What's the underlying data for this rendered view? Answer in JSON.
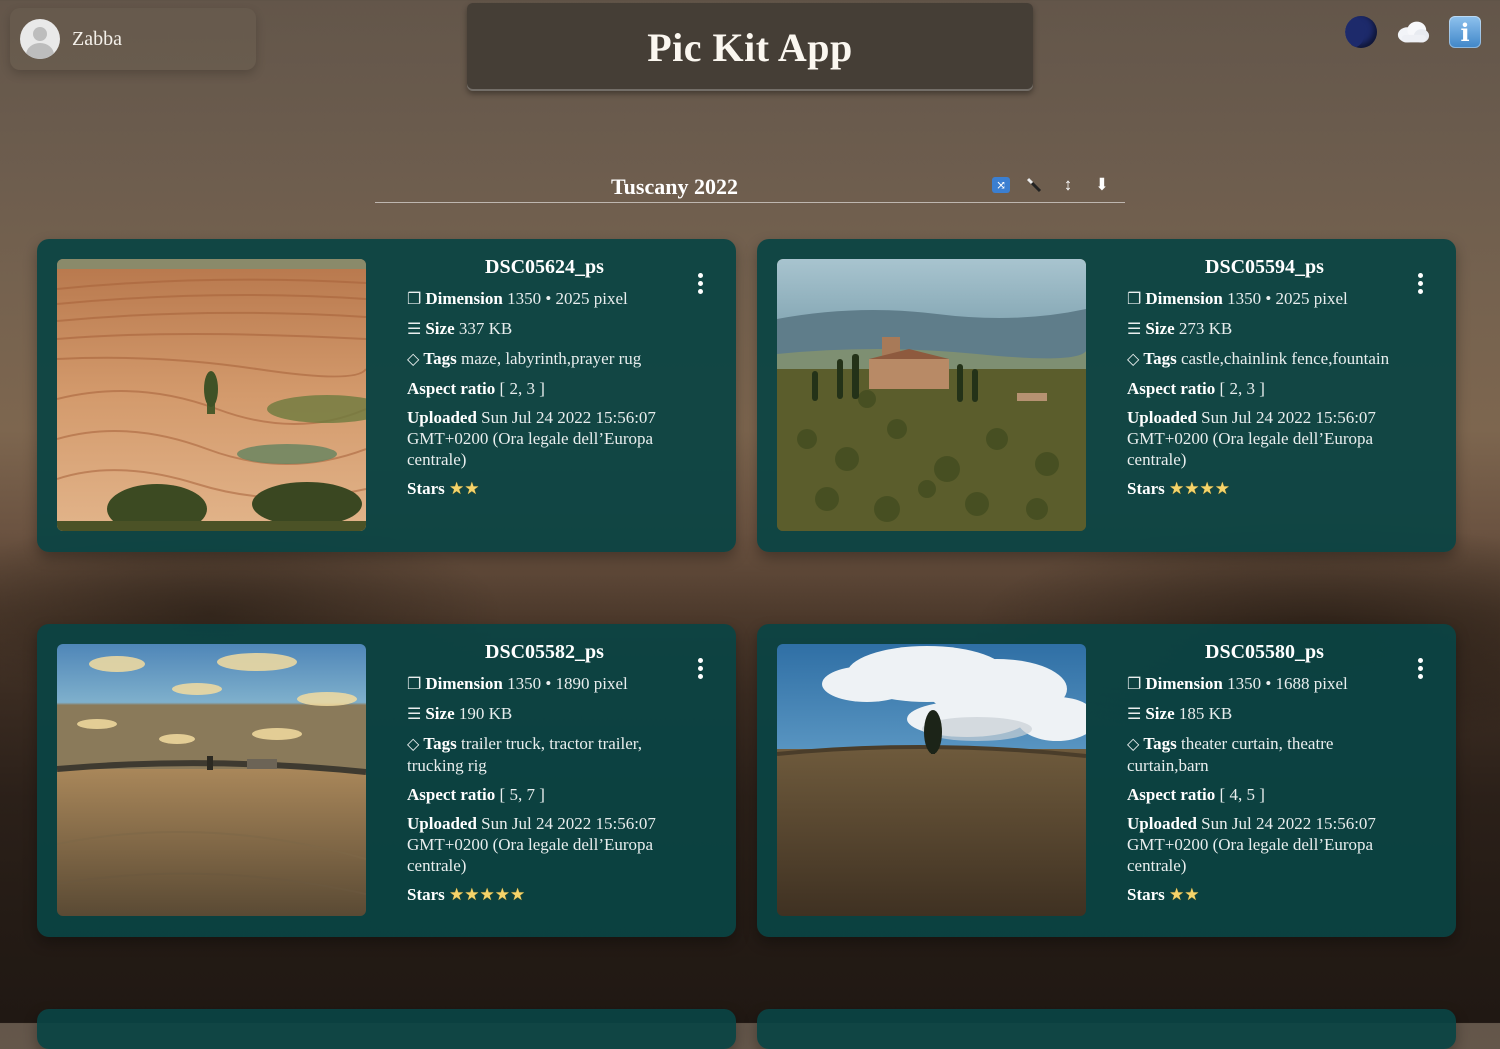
{
  "user": {
    "name": "Zabba"
  },
  "app": {
    "title": "Pic Kit App"
  },
  "top_icons": [
    "moon-icon",
    "cloud-icon",
    "info-icon"
  ],
  "album": {
    "title": "Tuscany 2022",
    "tools": [
      {
        "name": "shuffle-icon",
        "glyph": "🔀"
      },
      {
        "name": "wand-icon",
        "glyph": "⤡"
      },
      {
        "name": "sort-icon",
        "glyph": "↕"
      },
      {
        "name": "download-icon",
        "glyph": "⬇"
      }
    ]
  },
  "labels": {
    "dimension": "Dimension",
    "size": "Size",
    "tags": "Tags",
    "aspect": "Aspect ratio",
    "uploaded": "Uploaded",
    "stars": "Stars"
  },
  "photos": [
    {
      "name": "DSC05624_ps",
      "dimension": "1350 • 2025 pixel",
      "size": "337 KB",
      "tags": "maze, labyrinth,prayer rug",
      "aspect": "[ 2, 3 ]",
      "uploaded": "Sun Jul 24 2022 15:56:07 GMT+0200 (Ora legale dell’Europa centrale)",
      "stars": "★★"
    },
    {
      "name": "DSC05594_ps",
      "dimension": "1350 • 2025 pixel",
      "size": "273 KB",
      "tags": "castle,chainlink fence,fountain",
      "aspect": "[ 2, 3 ]",
      "uploaded": "Sun Jul 24 2022 15:56:07 GMT+0200 (Ora legale dell’Europa centrale)",
      "stars": "★★★★"
    },
    {
      "name": "DSC05582_ps",
      "dimension": "1350 • 1890 pixel",
      "size": "190 KB",
      "tags": "trailer truck, tractor trailer, trucking rig",
      "aspect": "[ 5, 7 ]",
      "uploaded": "Sun Jul 24 2022 15:56:07 GMT+0200 (Ora legale dell’Europa centrale)",
      "stars": "★★★★★"
    },
    {
      "name": "DSC05580_ps",
      "dimension": "1350 • 1688 pixel",
      "size": "185 KB",
      "tags": "theater curtain, theatre curtain,barn",
      "aspect": "[ 4, 5 ]",
      "uploaded": "Sun Jul 24 2022 15:56:07 GMT+0200 (Ora legale dell’Europa centrale)",
      "stars": "★★"
    }
  ]
}
